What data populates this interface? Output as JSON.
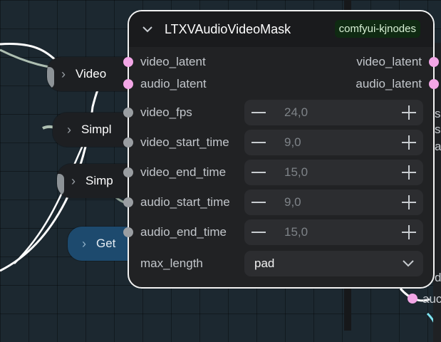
{
  "node": {
    "title": "LTXVAudioVideoMask",
    "badge": "comfyui-kjnodes",
    "outputs": [
      "video_latent",
      "audio_latent"
    ],
    "inputs": [
      "video_latent",
      "audio_latent"
    ],
    "widgets": [
      {
        "label": "video_fps",
        "value": "24,0"
      },
      {
        "label": "video_start_time",
        "value": "9,0"
      },
      {
        "label": "video_end_time",
        "value": "15,0"
      },
      {
        "label": "audio_start_time",
        "value": "9,0"
      },
      {
        "label": "audio_end_time",
        "value": "15,0"
      }
    ],
    "combo": {
      "label": "max_length",
      "value": "pad"
    }
  },
  "background_nodes": [
    {
      "label": "Video"
    },
    {
      "label": "Simpl"
    },
    {
      "label": "Simp"
    },
    {
      "label": "Get"
    }
  ],
  "right_fragments": [
    "s",
    "s",
    "a",
    "d",
    "auc"
  ],
  "colors": {
    "latent_socket": "#f2a6e6",
    "float_socket": "#9a9ea2",
    "badge_bg": "#0f2a12",
    "get_node_bg": "#1d4a6e",
    "selection_border": "#f2f2f2"
  },
  "icons": [
    "chevron-down-icon",
    "chevron-right-icon",
    "minus-icon",
    "plus-icon"
  ]
}
